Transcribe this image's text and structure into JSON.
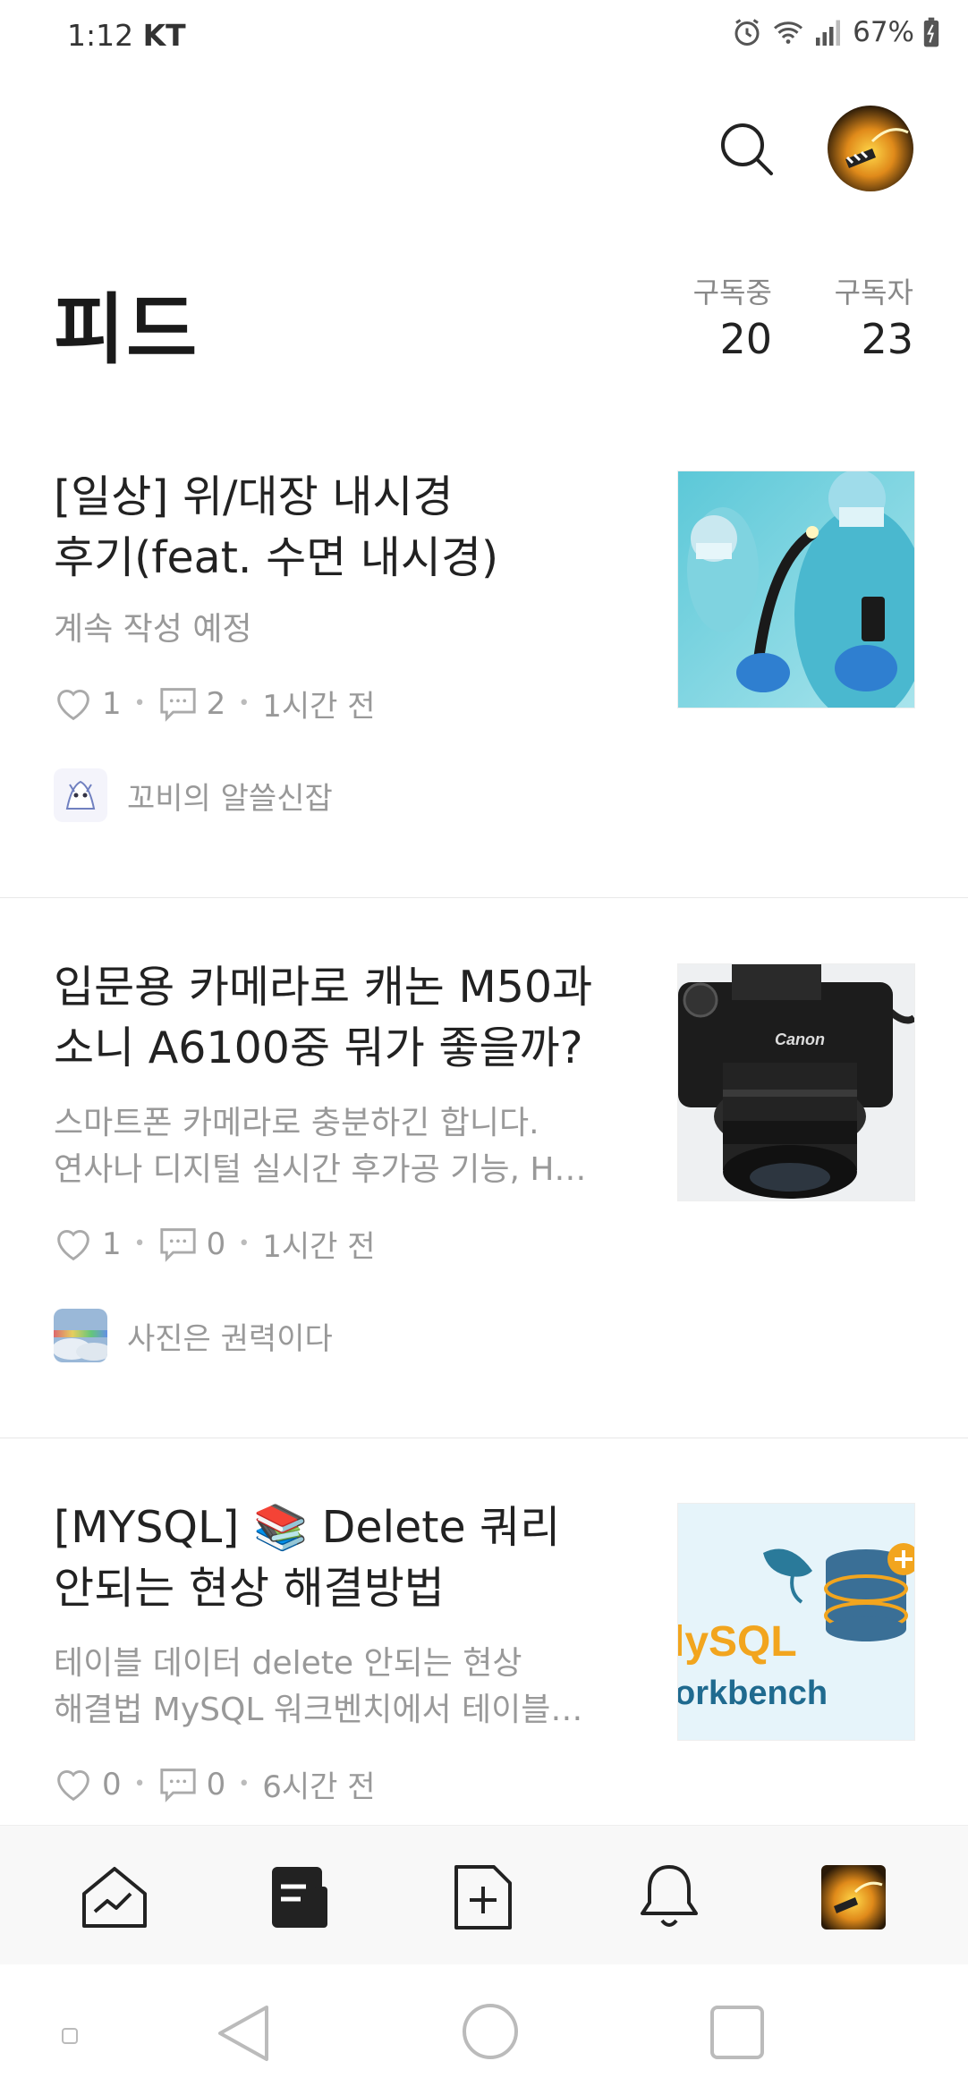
{
  "status_bar": {
    "time": "1:12",
    "carrier": "KT",
    "battery": "67%"
  },
  "header": {
    "title": "피드"
  },
  "stats": [
    {
      "label": "구독중",
      "value": "20"
    },
    {
      "label": "구독자",
      "value": "23"
    }
  ],
  "posts": [
    {
      "title_line1": "[일상] 위/대장 내시경",
      "title_line2": "후기(feat. 수면 내시경)",
      "excerpt_line1": "계속 작성 예정",
      "excerpt_line2": "",
      "likes": "1",
      "comments": "2",
      "time": "1시간 전",
      "blog_name": "꼬비의 알쓸신잡"
    },
    {
      "title_line1": "입문용 카메라로 캐논 M50과",
      "title_line2": "소니 A6100중 뭐가 좋을까?",
      "excerpt_line1": "스마트폰 카메라로 충분하긴 합니다.",
      "excerpt_line2": "연사나 디지털 실시간 후가공 기능, H…",
      "likes": "1",
      "comments": "0",
      "time": "1시간 전",
      "blog_name": "사진은 권력이다",
      "thumb_brand": "Canon"
    },
    {
      "title_line1_prefix": "[MYSQL]",
      "title_line1_emoji": "📚",
      "title_line1_suffix": "Delete 쿼리",
      "title_line2": "안되는 현상 해결방법",
      "excerpt_line1": "테이블 데이터 delete 안되는 현상",
      "excerpt_line2": "해결법 MySQL 워크벤치에서 테이블…",
      "likes": "0",
      "comments": "0",
      "time": "6시간 전",
      "thumb_text1": "lySQL",
      "thumb_text2": "orkbench"
    }
  ],
  "bottom_nav": [
    "home-stats",
    "feed",
    "new-post",
    "notifications",
    "profile"
  ],
  "colors": {
    "accent": "#222222",
    "muted": "#999999",
    "nav_bg": "#f8f8f8"
  }
}
